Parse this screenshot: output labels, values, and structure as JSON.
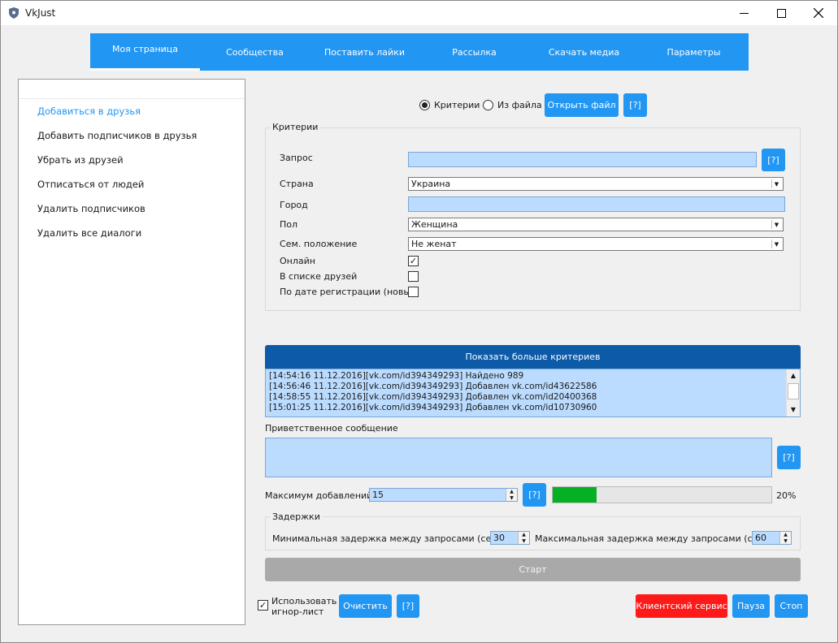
{
  "window": {
    "title": "VkJust"
  },
  "tabs": [
    {
      "label": "Моя страница",
      "active": true
    },
    {
      "label": "Сообщества"
    },
    {
      "label": "Поставить лайки"
    },
    {
      "label": "Рассылка"
    },
    {
      "label": "Скачать медиа"
    },
    {
      "label": "Параметры"
    }
  ],
  "sidebar": {
    "items": [
      {
        "label": "Добавиться в друзья",
        "active": true
      },
      {
        "label": "Добавить подписчиков в друзья"
      },
      {
        "label": "Убрать из друзей"
      },
      {
        "label": "Отписаться от людей"
      },
      {
        "label": "Удалить подписчиков"
      },
      {
        "label": "Удалить все диалоги"
      }
    ]
  },
  "source": {
    "criteria_label": "Критерии",
    "file_label": "Из файла",
    "open_file_label": "Открыть файл",
    "help_label": "[?]",
    "selected": "criteria"
  },
  "criteria": {
    "group_title": "Критерии",
    "query_label": "Запрос",
    "query_value": "",
    "country_label": "Страна",
    "country_value": "Украина",
    "city_label": "Город",
    "city_value": "",
    "gender_label": "Пол",
    "gender_value": "Женщина",
    "marital_label": "Сем. положение",
    "marital_value": "Не женат",
    "online_label": "Онлайн",
    "online_checked": true,
    "in_friends_label": "В списке друзей",
    "in_friends_checked": false,
    "by_reg_date_label": "По дате регистрации (новые)",
    "by_reg_date_checked": false,
    "help_label": "[?]"
  },
  "more_criteria_label": "Показать больше критериев",
  "log": [
    "[14:54:16 11.12.2016][vk.com/id394349293] Найдено 989",
    "[14:56:46 11.12.2016][vk.com/id394349293] Добавлен vk.com/id43622586",
    "[14:58:55 11.12.2016][vk.com/id394349293] Добавлен vk.com/id20400368",
    "[15:01:25 11.12.2016][vk.com/id394349293] Добавлен vk.com/id10730960"
  ],
  "greeting": {
    "label": "Приветственное сообщение",
    "value": "",
    "help_label": "[?]"
  },
  "max_adds": {
    "label": "Максимум добавлений:",
    "value": "15",
    "help_label": "[?]"
  },
  "progress": {
    "percent": 20,
    "label": "20%"
  },
  "delays": {
    "group_title": "Задержки",
    "min_label": "Минимальная задержка между запросами (сек.):",
    "min_value": "30",
    "max_label": "Максимальная задержка между запросами (сек.):",
    "max_value": "60"
  },
  "start_label": "Старт",
  "footer": {
    "ignore_list_line1": "Использовать",
    "ignore_list_line2": "игнор-лист",
    "ignore_list_checked": true,
    "clear_label": "Очистить",
    "help_label": "[?]",
    "client_service_label": "Клиентский сервис",
    "pause_label": "Пауза",
    "stop_label": "Стоп"
  },
  "colors": {
    "accent": "#2196f3",
    "dark_accent": "#0d5aa8",
    "danger": "#ff1a1a",
    "field": "#bcdcff",
    "progress": "#06b025"
  }
}
